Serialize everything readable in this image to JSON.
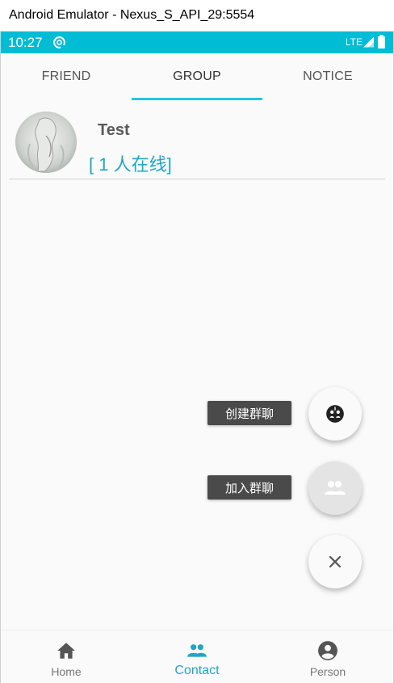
{
  "window": {
    "title": "Android Emulator - Nexus_S_API_29:5554"
  },
  "status_bar": {
    "time": "10:27",
    "network": "LTE"
  },
  "tabs": [
    {
      "label": "FRIEND"
    },
    {
      "label": "GROUP"
    },
    {
      "label": "NOTICE"
    }
  ],
  "active_tab": "GROUP",
  "groups": [
    {
      "name": "Test",
      "online": "[ 1 人在线]"
    }
  ],
  "fab_menu": {
    "create_label": "创建群聊",
    "join_label": "加入群聊",
    "create_icon": "group-add-icon",
    "join_icon": "people-icon",
    "close_icon": "close-icon"
  },
  "bottom_nav": [
    {
      "label": "Home",
      "icon": "home-icon"
    },
    {
      "label": "Contact",
      "icon": "people-icon"
    },
    {
      "label": "Person",
      "icon": "account-circle-icon"
    }
  ],
  "colors": {
    "accent": "#00bcd4",
    "active_text": "#1ea6c9",
    "fab_label_bg": "#4a4a4a"
  }
}
